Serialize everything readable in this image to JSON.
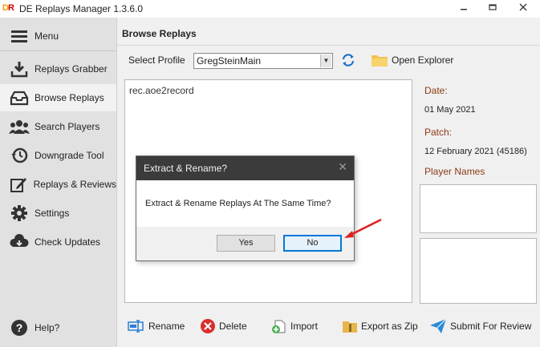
{
  "window": {
    "logo_text": "DE",
    "title": "DE Replays Manager 1.3.6.0",
    "controls": [
      "minimize-icon",
      "restore-icon",
      "close-icon"
    ]
  },
  "sidebar": {
    "items": [
      {
        "label": "Menu",
        "icon": "menu-icon",
        "active": false
      },
      {
        "label": "Replays Grabber",
        "icon": "download-icon",
        "active": false
      },
      {
        "label": "Browse Replays",
        "icon": "inbox-tray-icon",
        "active": true
      },
      {
        "label": "Search Players",
        "icon": "users-icon",
        "active": false
      },
      {
        "label": "Downgrade Tool",
        "icon": "history-icon",
        "active": false
      },
      {
        "label": "Replays & Reviews",
        "icon": "edit-icon",
        "active": false
      },
      {
        "label": "Settings",
        "icon": "gear-icon",
        "active": false
      },
      {
        "label": "Check Updates",
        "icon": "cloud-download-icon",
        "active": false
      },
      {
        "label": "Help?",
        "icon": "help-icon",
        "active": false
      }
    ]
  },
  "main": {
    "title": "Browse Replays",
    "profile_label": "Select Profile",
    "profile_value": "GregSteinMain",
    "open_explorer_label": "Open Explorer",
    "replays": [
      "rec.aoe2record"
    ],
    "info": {
      "date_label": "Date:",
      "date_value": "01 May 2021",
      "patch_label": "Patch:",
      "patch_value": "12 February 2021 (45186)",
      "players_label": "Player Names"
    },
    "toolbar": {
      "rename": "Rename",
      "delete": "Delete",
      "import": "Import",
      "export": "Export as Zip",
      "submit": "Submit For Review"
    }
  },
  "dialog": {
    "title": "Extract & Rename?",
    "message": "Extract & Rename Replays At The Same Time?",
    "yes_label": "Yes",
    "no_label": "No",
    "default_button": "No"
  },
  "colors": {
    "accent": "#0078d7",
    "info_label": "#8b3a14",
    "dialog_titlebar": "#3b3b3b",
    "annotation_arrow": "#e02020"
  }
}
